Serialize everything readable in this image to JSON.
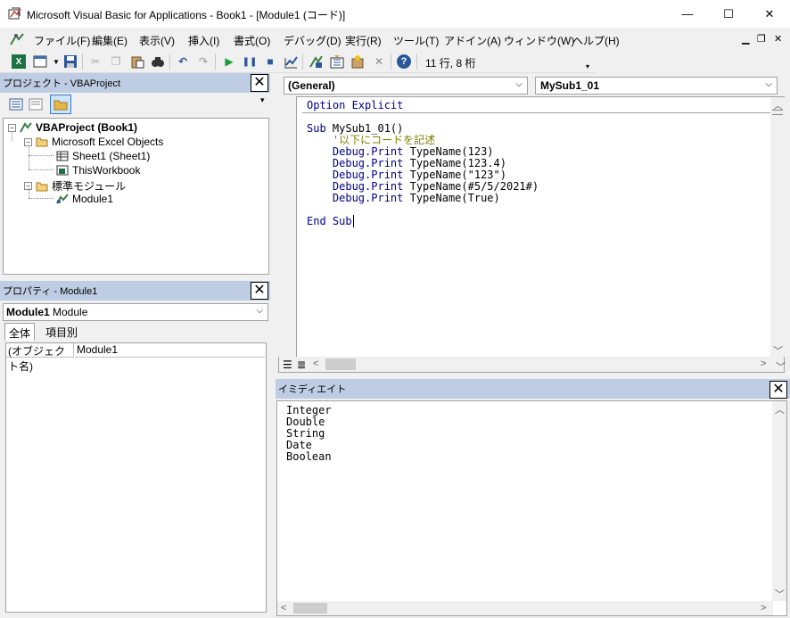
{
  "window": {
    "title": "Microsoft Visual Basic for Applications - Book1 - [Module1 (コード)]",
    "minimize": "—",
    "maximize": "☐",
    "close": "✕"
  },
  "menu": [
    "ファイル(F)",
    "編集(E)",
    "表示(V)",
    "挿入(I)",
    "書式(O)",
    "デバッグ(D)",
    "実行(R)",
    "ツール(T)",
    "アドイン(A)",
    "ウィンドウ(W)",
    "ヘルプ(H)"
  ],
  "toolbar": {
    "position": "11 行, 8 桁"
  },
  "project": {
    "header": "プロジェクト - VBAProject",
    "tree": {
      "root": "VBAProject (Book1)",
      "excel_objects": "Microsoft Excel Objects",
      "sheet1": "Sheet1 (Sheet1)",
      "thisworkbook": "ThisWorkbook",
      "modules": "標準モジュール",
      "module1": "Module1"
    }
  },
  "properties": {
    "header": "プロパティ - Module1",
    "object_name": "Module1",
    "object_type": "Module",
    "tabs": [
      "全体",
      "項目別"
    ],
    "row_name": "(オブジェクト名)",
    "row_value": "Module1"
  },
  "code": {
    "object_combo": "(General)",
    "proc_combo": "MySub1_01",
    "lines": {
      "l1_kw": "Option Explicit",
      "l2_kw": "Sub",
      "l2_rest": " MySub1_01()",
      "l3_cm": "    '以下にコードを記述",
      "l4_kw": "    Debug.Print",
      "l4_rest": " TypeName(123)",
      "l5_kw": "    Debug.Print",
      "l5_rest": " TypeName(123.4)",
      "l6_kw": "    Debug.Print",
      "l6_rest": " TypeName(\"123\")",
      "l7_kw": "    Debug.Print",
      "l7_rest": " TypeName(#5/5/2021#)",
      "l8_kw": "    Debug.Print",
      "l8_rest": " TypeName(True)",
      "l9_kw": "End Sub"
    }
  },
  "immediate": {
    "header": "イミディエイト",
    "output": [
      "Integer",
      "Double",
      "String",
      "Date",
      "Boolean"
    ]
  }
}
